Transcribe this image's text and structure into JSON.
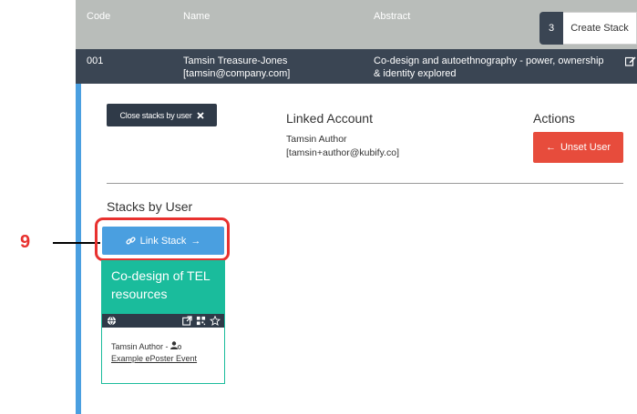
{
  "table": {
    "headers": {
      "code": "Code",
      "name": "Name",
      "abstract": "Abstract"
    },
    "create_stack": {
      "count": "3",
      "label": "Create Stack"
    },
    "row": {
      "code": "001",
      "name_line1": "Tamsin Treasure-Jones",
      "name_line2": "[tamsin@company.com]",
      "abstract_line1": "Co-design and autoethnography - power, ownership",
      "abstract_line2": "& identity explored"
    }
  },
  "panel": {
    "close_stacks_label": "Close stacks by user",
    "linked_account_title": "Linked Account",
    "linked_name": "Tamsin Author",
    "linked_email": "[tamsin+author@kubify.co]",
    "actions_title": "Actions",
    "unset_user_label": "Unset User",
    "stacks_by_user_title": "Stacks by User",
    "link_stack_label": "Link Stack",
    "card": {
      "title": "Co-design of TEL resources",
      "author": "Tamsin Author -",
      "event_link": "Example ePoster Event"
    }
  },
  "annotation": {
    "callout_number": "9"
  },
  "colors": {
    "header_bg": "#b9bdba",
    "row_bg": "#3a4553",
    "accent_blue": "#4a9fe0",
    "danger_red": "#e74c3c",
    "card_teal": "#1abc9c",
    "callout_red": "#e8312f"
  }
}
